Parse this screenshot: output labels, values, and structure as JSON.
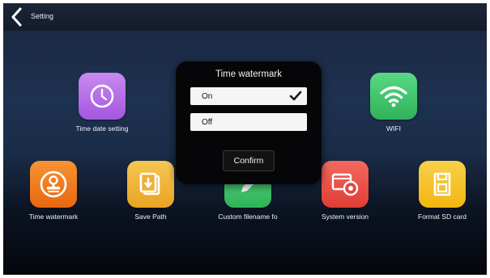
{
  "header": {
    "title": "Setting"
  },
  "tiles": [
    {
      "label": "Time date setting",
      "icon": "clock-icon",
      "color": "#b46ae6"
    },
    {
      "label": "WIFI",
      "icon": "wifi-icon",
      "color": "#3cc66a"
    },
    {
      "label": "Time watermark",
      "icon": "stamp-icon",
      "color": "#f07a1c"
    },
    {
      "label": "Save Path",
      "icon": "save-path-icon",
      "color": "#f0b52e"
    },
    {
      "label": "Custom filename fo",
      "icon": "pen-icon",
      "color": "#3cc66a"
    },
    {
      "label": "System version",
      "icon": "system-settings-icon",
      "color": "#ee4e44"
    },
    {
      "label": "Format SD card",
      "icon": "sd-card-icon",
      "color": "#f5c21a"
    }
  ],
  "dialog": {
    "title": "Time watermark",
    "options": [
      {
        "label": "On",
        "selected": true
      },
      {
        "label": "Off",
        "selected": false
      }
    ],
    "confirm_label": "Confirm"
  }
}
